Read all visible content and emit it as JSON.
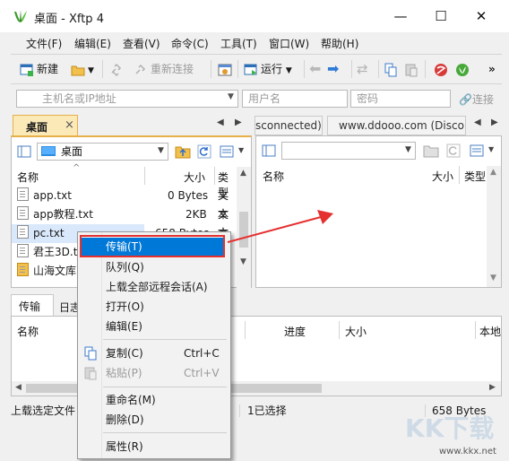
{
  "window": {
    "title": "桌面 - Xftp 4",
    "minimize": "—",
    "maximize": "☐",
    "close": "✕"
  },
  "menu": [
    "文件(F)",
    "编辑(E)",
    "查看(V)",
    "命令(C)",
    "工具(T)",
    "窗口(W)",
    "帮助(H)"
  ],
  "toolbar": {
    "new": "新建",
    "reconnect": "重新连接",
    "run": "运行",
    "more": "»"
  },
  "address": {
    "host_placeholder": "主机名或IP地址",
    "user_placeholder": "用户名",
    "password_placeholder": "密码",
    "connect": "连接"
  },
  "left_pane": {
    "tab": "桌面",
    "tab_close": "×",
    "path": "桌面",
    "columns": [
      "名称",
      "大小",
      "类型"
    ],
    "rows": [
      {
        "name": "app.txt",
        "size": "0 Bytes",
        "type": "文本"
      },
      {
        "name": "app教程.txt",
        "size": "2KB",
        "type": "文本"
      },
      {
        "name": "pc.txt",
        "size": "658 Bytes",
        "type": "文本"
      },
      {
        "name": "君王3D.txt",
        "size": "",
        "type": "文本"
      },
      {
        "name": "山海文库",
        "size": "",
        "type": ""
      }
    ]
  },
  "right_pane": {
    "tab1": "sconnected)",
    "tab2": "www.ddooo.com (Disco",
    "columns": [
      "名称",
      "大小",
      "类型"
    ]
  },
  "transfer": {
    "tab_transfer": "传输",
    "tab_log": "日志",
    "columns": [
      "名称",
      "进度",
      "大小",
      "本地"
    ]
  },
  "status": {
    "left": "上载选定文件",
    "middle": "1已选择",
    "right": "658 Bytes"
  },
  "context_menu": {
    "items": [
      {
        "label": "传输(T)",
        "shortcut": ""
      },
      {
        "label": "队列(Q)",
        "shortcut": ""
      },
      {
        "label": "上载全部远程会话(A)",
        "shortcut": ""
      },
      {
        "label": "打开(O)",
        "shortcut": ""
      },
      {
        "label": "编辑(E)",
        "shortcut": ""
      },
      {
        "label": "复制(C)",
        "shortcut": "Ctrl+C"
      },
      {
        "label": "粘贴(P)",
        "shortcut": "Ctrl+V"
      },
      {
        "label": "重命名(M)",
        "shortcut": ""
      },
      {
        "label": "删除(D)",
        "shortcut": ""
      },
      {
        "label": "属性(R)",
        "shortcut": ""
      }
    ]
  },
  "watermark": {
    "main": "KK下载",
    "url": "www.kkx.net"
  },
  "colors": {
    "highlight": "#0078d7",
    "annotation": "#e53030",
    "tab_active": "#fbe9b8"
  }
}
